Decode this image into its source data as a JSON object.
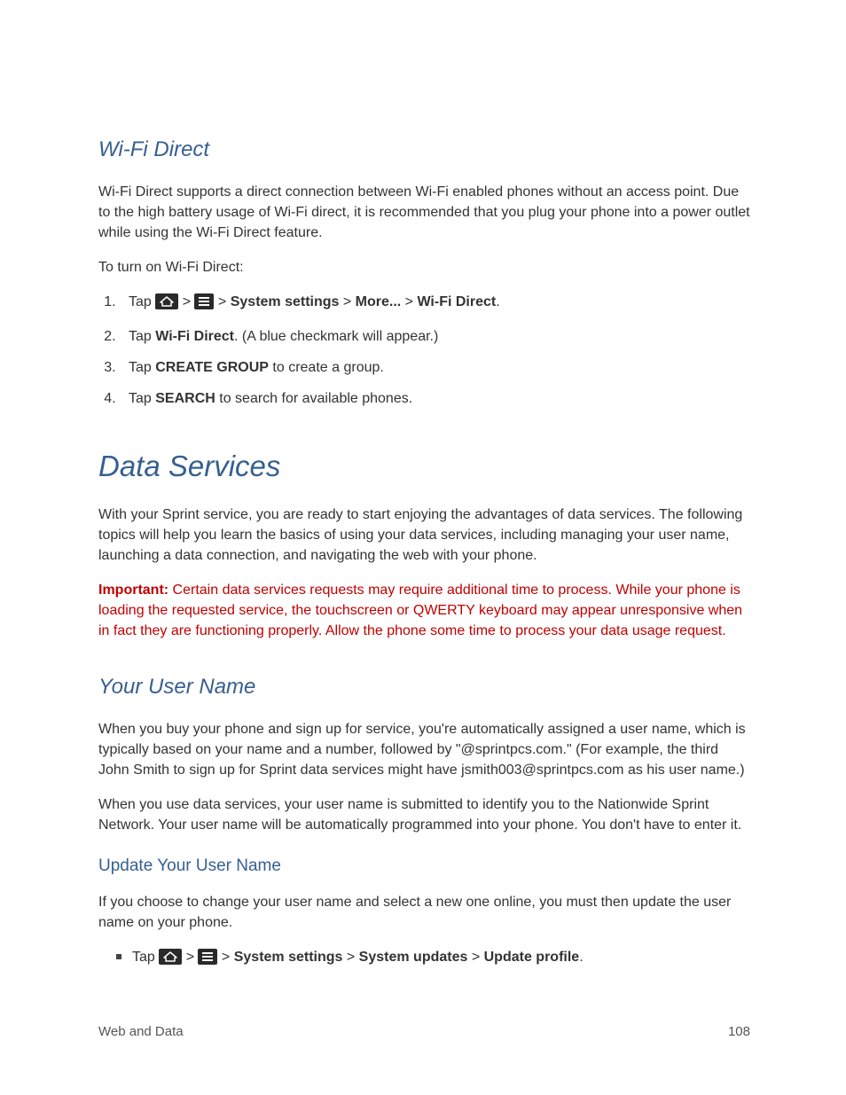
{
  "wifi": {
    "heading": "Wi-Fi Direct",
    "intro": "Wi-Fi Direct supports a direct connection between Wi-Fi enabled phones without an access point. Due to the high battery usage of Wi-Fi direct, it is recommended that you plug your phone into a power outlet while using the Wi-Fi Direct feature.",
    "turn_on_label": "To turn on Wi-Fi Direct:",
    "step1_pre": "Tap ",
    "step1_gt1": " > ",
    "step1_gt2": " > ",
    "step1_sys": "System settings",
    "step1_gt3": " > ",
    "step1_more": "More...",
    "step1_gt4": " > ",
    "step1_wifi": "Wi-Fi Direct",
    "step1_end": ".",
    "step2_pre": "Tap ",
    "step2_bold": "Wi-Fi Direct",
    "step2_post": ". (A blue checkmark will appear.)",
    "step3_pre": "Tap ",
    "step3_bold": "CREATE GROUP",
    "step3_post": " to create a group.",
    "step4_pre": "Tap ",
    "step4_bold": "SEARCH",
    "step4_post": " to search for available phones."
  },
  "data": {
    "heading": "Data Services",
    "intro": "With your Sprint service, you are ready to start enjoying the advantages of data services. The following topics will help you learn the basics of using your data services, including managing your user name, launching a data connection, and navigating the web with your phone.",
    "important_label": "Important:",
    "important_body": "  Certain data services requests may require additional time to process. While your phone is loading the requested service, the touchscreen or QWERTY keyboard may appear unresponsive when in fact they are functioning properly. Allow the phone some time to process your data usage request."
  },
  "user": {
    "heading": "Your User Name",
    "p1": "When you buy your phone and sign up for service, you're automatically assigned a user name, which is typically based on your name and a number, followed by \"@sprintpcs.com.\" (For example, the third John Smith to sign up for Sprint data services might have jsmith003@sprintpcs.com as his user name.)",
    "p2": "When you use data services, your user name is submitted to identify you to the Nationwide Sprint Network. Your user name will be automatically programmed into your phone. You don't have to enter it.",
    "update_heading": "Update Your User Name",
    "update_p": "If you choose to change your user name and select a new one online, you must then update the user name on your phone.",
    "bullet_pre": "Tap ",
    "bullet_gt1": " > ",
    "bullet_gt2": " > ",
    "bullet_sys": "System settings",
    "bullet_gt3": " > ",
    "bullet_updates": "System updates",
    "bullet_gt4": " > ",
    "bullet_profile": "Update profile",
    "bullet_end": "."
  },
  "footer": {
    "left": "Web and Data",
    "right": "108"
  }
}
